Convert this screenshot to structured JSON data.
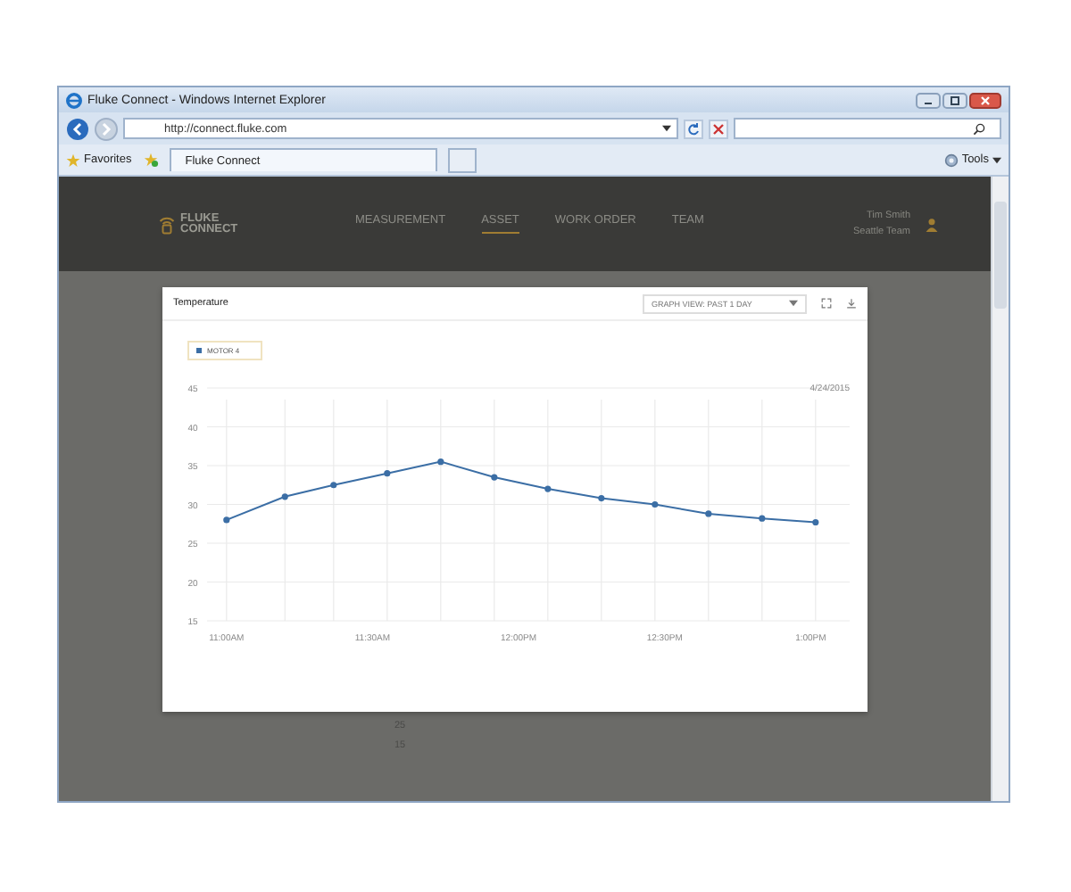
{
  "window": {
    "title": "Fluke Connect - Windows Internet Explorer"
  },
  "address_bar": {
    "url": "http://connect.fluke.com"
  },
  "favorites_bar": {
    "favorites": "Favorites",
    "tabs": [
      {
        "label": "Fluke Connect",
        "selected": true
      }
    ],
    "tools": "Tools"
  },
  "app": {
    "logo": [
      "FLUKE",
      "CONNECT"
    ],
    "nav": [
      {
        "label": "MEASUREMENT",
        "selected": false
      },
      {
        "label": "ASSET",
        "selected": true
      },
      {
        "label": "WORK ORDER",
        "selected": false
      },
      {
        "label": "TEAM",
        "selected": false
      }
    ],
    "user": {
      "name": "Tim Smith",
      "team": "Seattle Team"
    }
  },
  "background_chart": {
    "labels": [
      "25",
      "15"
    ]
  },
  "modal": {
    "title": "Temperature",
    "graph_view": "GRAPH VIEW: PAST 1 DAY",
    "date": "4/24/2015",
    "chart_data": {
      "type": "line",
      "x": [
        660,
        672,
        682,
        693,
        704,
        715,
        726,
        737,
        748,
        759,
        770,
        781
      ],
      "grid": true,
      "xlim": [
        656,
        788
      ],
      "series": [
        {
          "name": "MOTOR 4",
          "color": "#3b6ea5",
          "marker": "circle",
          "values": [
            28,
            31,
            32.5,
            34,
            35.5,
            33.5,
            32,
            30.8,
            30,
            28.8,
            28.2,
            27.7
          ]
        }
      ],
      "ylim": [
        15,
        45
      ],
      "yticks": [
        15,
        20,
        25,
        30,
        35,
        40,
        45
      ],
      "xticks": [
        {
          "value": 660,
          "label": "11:00AM"
        },
        {
          "value": 690,
          "label": "11:30AM"
        },
        {
          "value": 720,
          "label": "12:00PM"
        },
        {
          "value": 750,
          "label": "12:30PM"
        },
        {
          "value": 780,
          "label": "1:00PM"
        }
      ]
    }
  }
}
